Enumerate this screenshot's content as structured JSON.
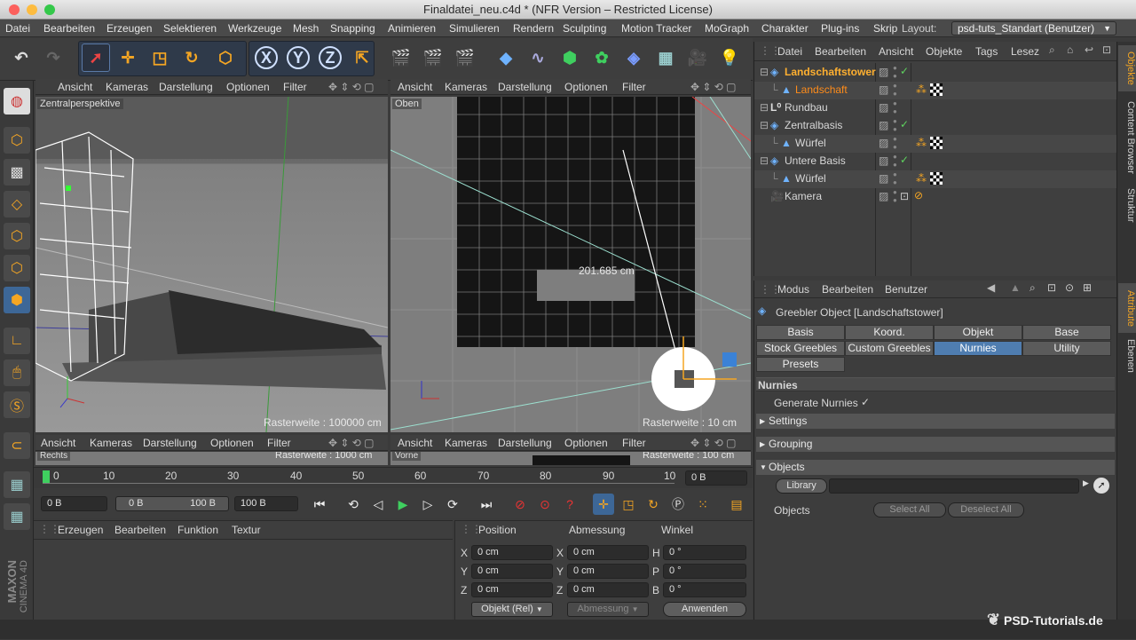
{
  "window": {
    "title": "Finaldatei_neu.c4d * (NFR Version – Restricted License)"
  },
  "menu": [
    "Datei",
    "Bearbeiten",
    "Erzeugen",
    "Selektieren",
    "Werkzeuge",
    "Mesh",
    "Snapping",
    "Animieren",
    "Simulieren",
    "Rendern",
    "Sculpting",
    "Motion Tracker",
    "MoGraph",
    "Charakter",
    "Plug-ins",
    "Skrip"
  ],
  "layout": {
    "label": "Layout:",
    "value": "psd-tuts_Standart (Benutzer)"
  },
  "viewport_menu": [
    "Ansicht",
    "Kameras",
    "Darstellung",
    "Optionen",
    "Filter"
  ],
  "viewports": {
    "tl": {
      "label": "Zentralperspektive",
      "raster": "Rasterweite : 100000 cm"
    },
    "tr": {
      "label": "Oben",
      "raster": "Rasterweite : 10 cm",
      "measure": "201.685 cm"
    },
    "bl": {
      "label": "Rechts",
      "raster": "Rasterweite : 1000 cm"
    },
    "br": {
      "label": "Vorne",
      "raster": "Rasterweite : 100 cm"
    }
  },
  "timeline": {
    "ticks": [
      "0",
      "10",
      "20",
      "30",
      "40",
      "50",
      "60",
      "70",
      "80",
      "90",
      "10"
    ],
    "frame": "0 B",
    "start": "0 B",
    "range_a": "0 B",
    "range_b": "100 B",
    "end": "100 B"
  },
  "material_manager": {
    "menu": [
      "Erzeugen",
      "Bearbeiten",
      "Funktion",
      "Textur"
    ]
  },
  "coordinates": {
    "headers": [
      "Position",
      "Abmessung",
      "Winkel"
    ],
    "rows": [
      {
        "a": "X",
        "pos": "0 cm",
        "b": "X",
        "size": "0 cm",
        "c": "H",
        "rot": "0 °"
      },
      {
        "a": "Y",
        "pos": "0 cm",
        "b": "Y",
        "size": "0 cm",
        "c": "P",
        "rot": "0 °"
      },
      {
        "a": "Z",
        "pos": "0 cm",
        "b": "Z",
        "size": "0 cm",
        "c": "B",
        "rot": "0 °"
      }
    ],
    "mode": "Objekt (Rel)",
    "size_mode": "Abmessung",
    "apply": "Anwenden"
  },
  "object_manager": {
    "menu": [
      "Datei",
      "Bearbeiten",
      "Ansicht",
      "Objekte",
      "Tags",
      "Lesez"
    ],
    "objects": [
      {
        "name": "Landschaftstower",
        "indent": 0,
        "color": "#ffb030"
      },
      {
        "name": "Landschaft",
        "indent": 1,
        "color": "#ff8c1a"
      },
      {
        "name": "Rundbau",
        "indent": 0,
        "color": "#e8e8e8"
      },
      {
        "name": "Zentralbasis",
        "indent": 0,
        "color": "#e8e8e8"
      },
      {
        "name": "Würfel",
        "indent": 1,
        "color": "#e8e8e8"
      },
      {
        "name": "Untere Basis",
        "indent": 0,
        "color": "#e8e8e8"
      },
      {
        "name": "Würfel",
        "indent": 1,
        "color": "#e8e8e8"
      },
      {
        "name": "Kamera",
        "indent": 0,
        "color": "#e8e8e8"
      }
    ]
  },
  "attributes": {
    "menu": [
      "Modus",
      "Bearbeiten",
      "Benutzer"
    ],
    "title": "Greebler Object [Landschaftstower]",
    "tabs_row1": [
      "Basis",
      "Koord.",
      "Objekt",
      "Base"
    ],
    "tabs_row2": [
      "Stock Greebles",
      "Custom Greebles",
      "Nurnies",
      "Utility"
    ],
    "tabs_row3": [
      "Presets"
    ],
    "section": "Nurnies",
    "generate_label": "Generate Nurnies",
    "generate_value": "✓",
    "groups": [
      "Settings",
      "Grouping",
      "Objects"
    ],
    "library_label": "Library",
    "objects_label": "Objects",
    "select_all": "Select All",
    "deselect_all": "Deselect All"
  },
  "right_tabs": [
    "Objekte",
    "Content Browser",
    "Struktur",
    "Attribute",
    "Ebenen"
  ],
  "branding": {
    "maxon": "MAXON",
    "cinema": "CINEMA 4D",
    "watermark": "PSD-Tutorials.de"
  },
  "colors": {
    "accent": "#4f7db0",
    "active_object": "#ffb030",
    "check": "#5fd35f"
  }
}
